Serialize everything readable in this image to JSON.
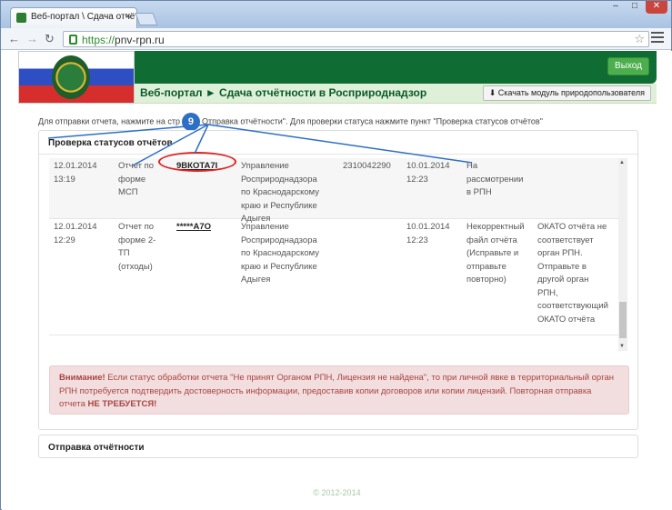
{
  "browser": {
    "tab_title": "Веб-портал \\ Сдача отчётн...",
    "tab_close": "×",
    "url_scheme": "https://",
    "url_host": "pnv-rpn.ru",
    "window_controls": [
      "–",
      "□",
      "✕"
    ]
  },
  "header": {
    "logout_label": "Выход",
    "page_title": "Веб-портал ► Сдача отчётности в Росприроднадзор",
    "download_label": "Скачать модуль природопользователя"
  },
  "info": {
    "before_marker": "Для отправки отчета, нажмите на стр",
    "marker": "9",
    "after_marker": "Отправка отчётности\". Для проверки статуса нажмите пункт \"Проверка статусов отчётов\""
  },
  "status_panel": {
    "heading": "Проверка статусов отчётов",
    "rows": [
      {
        "date": "12.01.2014\n13:19",
        "form": "Отчет по\nформе\nМСП",
        "id": "9ВКОТА7І",
        "org": "Управление\nРосприроднадзора\nпо Краснодарскому\nкраю и Республике\nАдыгея",
        "inn": "2310042290",
        "date2": "10.01.2014\n12:23",
        "status": "На\nрассмотрении\nв РПН",
        "comment": ""
      },
      {
        "date": "12.01.2014\n12:29",
        "form": "Отчет по\nформе 2-\nТП\n(отходы)",
        "id": "*****А7О",
        "org": "Управление\nРосприроднадзора\nпо Краснодарскому\nкраю и Республике\nАдыгея",
        "inn": "",
        "date2": "10.01.2014\n12:23",
        "status": "Некорректный\nфайл отчёта\n(Исправьте и\nотправьте\nповторно)",
        "comment": "ОКАТО отчёта не\nсоответствует\nорган РПН.\nОтправьте в\nдругой орган\nРПН,\nсоответствующий\nОКАТО отчёта"
      }
    ]
  },
  "alert": {
    "strong": "Внимание!",
    "text": " Если статус обработки отчета \"Не принят Органом РПН, Лицензия не найдена\", то при личной явке в территориальный орган РПН потребуется подтвердить достоверность информации, предоставив копии договоров или копии лицензий. Повторная отправка отчета ",
    "emphasis": "НЕ ТРЕБУЕТСЯ!"
  },
  "send_panel": {
    "heading": "Отправка отчётности"
  },
  "footer": {
    "copyright": "© 2012-2014"
  },
  "colors": {
    "header_green": "#0f6d34",
    "title_bg": "#dff0d8",
    "alert_text": "#a94442",
    "marker_blue": "#2d6fc4",
    "highlight_red": "#dd2222"
  }
}
